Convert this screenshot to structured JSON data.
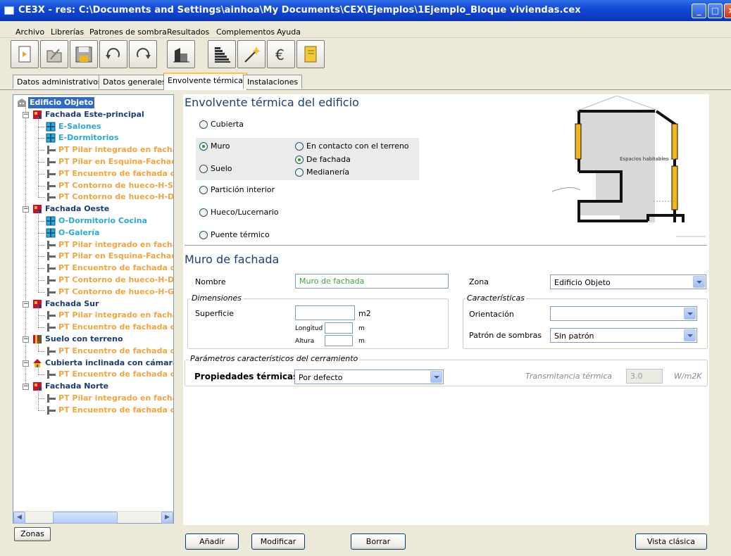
{
  "window": {
    "title": "CE3X - res: C:\\Documents and Settings\\ainhoa\\My Documents\\CEX\\Ejemplos\\1Ejemplo_Bloque viviendas.cex",
    "buttons": [
      "minimize",
      "maximize",
      "close"
    ]
  },
  "menu": [
    "Archivo",
    "Librerías",
    "Patrones de sombra",
    "Resultados",
    "Complementos",
    "Ayuda"
  ],
  "toolbar": {
    "buttons": [
      "new-file-icon",
      "open-folder-icon",
      "save-icon",
      "undo-icon",
      "redo-icon",
      "building-icon",
      "rating-bars-icon",
      "wand-icon",
      "euro-icon",
      "report-icon"
    ]
  },
  "tabs": [
    {
      "label": "Datos administrativos",
      "active": false
    },
    {
      "label": "Datos generales",
      "active": false
    },
    {
      "label": "Envolvente térmica",
      "active": true
    },
    {
      "label": "Instalaciones",
      "active": false
    }
  ],
  "tree": {
    "root": "Edificio Objeto",
    "nodes": [
      {
        "label": "Fachada Este-principal",
        "kind": "facade",
        "children": [
          {
            "label": "E-Salones",
            "kind": "window"
          },
          {
            "label": "E-Dormitorios",
            "kind": "window"
          },
          {
            "label": "PT Pilar integrado en facha",
            "kind": "bridge"
          },
          {
            "label": "PT Pilar en Esquina-Fachad",
            "kind": "bridge"
          },
          {
            "label": "PT Encuentro de fachada cc",
            "kind": "bridge"
          },
          {
            "label": "PT Contorno de hueco-H-Sa",
            "kind": "bridge"
          },
          {
            "label": "PT Contorno de hueco-H-Dc",
            "kind": "bridge"
          }
        ]
      },
      {
        "label": "Fachada Oeste",
        "kind": "facade",
        "children": [
          {
            "label": "O-Dormitorio Cocina",
            "kind": "window"
          },
          {
            "label": "O-Galería",
            "kind": "window"
          },
          {
            "label": "PT Pilar integrado en facha",
            "kind": "bridge"
          },
          {
            "label": "PT Pilar en Esquina-Fachad",
            "kind": "bridge"
          },
          {
            "label": "PT Encuentro de fachada cc",
            "kind": "bridge"
          },
          {
            "label": "PT Contorno de hueco-H-Dc",
            "kind": "bridge"
          },
          {
            "label": "PT Contorno de hueco-H-Ga",
            "kind": "bridge"
          }
        ]
      },
      {
        "label": "Fachada Sur",
        "kind": "facade",
        "children": [
          {
            "label": "PT Pilar integrado en facha",
            "kind": "bridge"
          },
          {
            "label": "PT Encuentro de fachada cc",
            "kind": "bridge"
          }
        ]
      },
      {
        "label": "Suelo con terreno",
        "kind": "floor",
        "children": [
          {
            "label": "PT Encuentro de fachada cc",
            "kind": "bridge"
          }
        ]
      },
      {
        "label": "Cubierta inclinada con cámara",
        "kind": "roof",
        "children": [
          {
            "label": "PT Encuentro de fachada cc",
            "kind": "bridge"
          }
        ]
      },
      {
        "label": "Fachada Norte",
        "kind": "facade",
        "children": [
          {
            "label": "PT Pilar integrado en facha",
            "kind": "bridge"
          },
          {
            "label": "PT Encuentro de fachada cc",
            "kind": "bridge"
          }
        ]
      }
    ]
  },
  "zonas_button": "Zonas",
  "envelope": {
    "title": "Envolvente térmica del edificio",
    "types": [
      {
        "label": "Cubierta",
        "selected": false
      },
      {
        "label": "Muro",
        "selected": true
      },
      {
        "label": "Suelo",
        "selected": false
      },
      {
        "label": "Partición interior",
        "selected": false
      },
      {
        "label": "Hueco/Lucernario",
        "selected": false
      },
      {
        "label": "Puente térmico",
        "selected": false
      }
    ],
    "subtypes": [
      {
        "label": "En contacto con el terreno",
        "selected": false
      },
      {
        "label": "De fachada",
        "selected": true
      },
      {
        "label": "Medianería",
        "selected": false
      }
    ],
    "diagram_label": "Espacios habitables"
  },
  "form": {
    "section_title": "Muro de fachada",
    "nombre_label": "Nombre",
    "nombre_value": "Muro de fachada",
    "zona_label": "Zona",
    "zona_value": "Edificio Objeto",
    "dimensiones_legend": "Dimensiones",
    "superficie_label": "Superficie",
    "superficie_value": "",
    "superficie_unit": "m2",
    "longitud_label": "Longitud",
    "longitud_value": "",
    "longitud_unit": "m",
    "altura_label": "Altura",
    "altura_value": "",
    "altura_unit": "m",
    "caracteristicas_legend": "Características",
    "orientacion_label": "Orientación",
    "orientacion_value": "",
    "patron_label": "Patrón de sombras",
    "patron_value": "Sin patrón",
    "parametros_legend": "Parámetros característicos del cerramiento",
    "propiedades_label": "Propiedades térmicas",
    "propiedades_value": "Por defecto",
    "transmitancia_label": "Transmitancia térmica",
    "transmitancia_value": "3.0",
    "transmitancia_unit": "W/m2K"
  },
  "actions": {
    "add": "Añadir",
    "modify": "Modificar",
    "delete": "Borrar",
    "classic": "Vista clásica"
  },
  "colors": {
    "titlebar": "#0a3bc2",
    "heading": "#1c3f72",
    "tree_dark": "#1a3c78",
    "tree_cyan": "#2aa9d8",
    "tree_orange": "#f3a43f",
    "nombre_text": "#3aa43a",
    "diagram_yellow": "#f2b51a"
  }
}
